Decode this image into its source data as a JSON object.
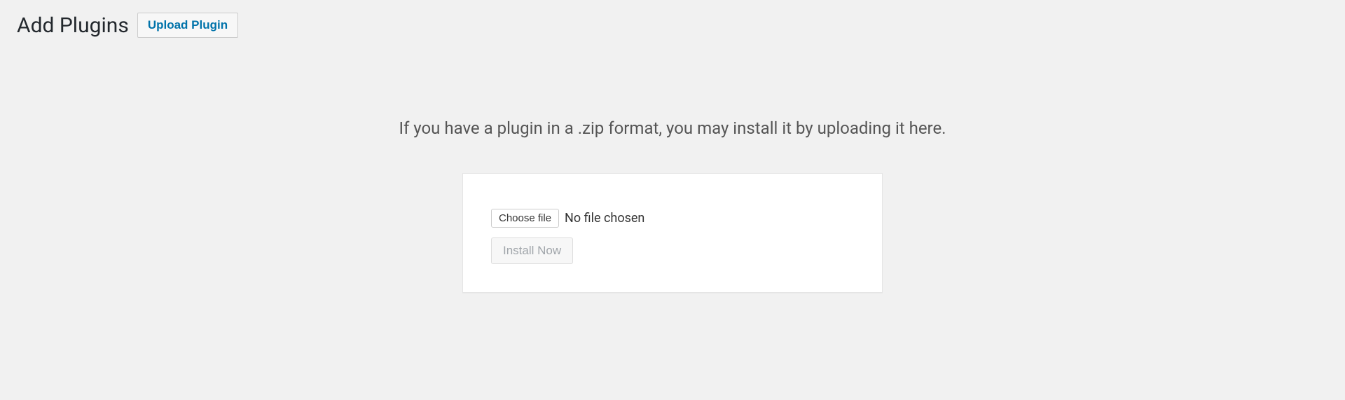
{
  "header": {
    "title": "Add Plugins",
    "upload_button": "Upload Plugin"
  },
  "instruction": "If you have a plugin in a .zip format, you may install it by uploading it here.",
  "upload": {
    "choose_file_label": "Choose file",
    "file_status": "No file chosen",
    "install_button": "Install Now"
  }
}
